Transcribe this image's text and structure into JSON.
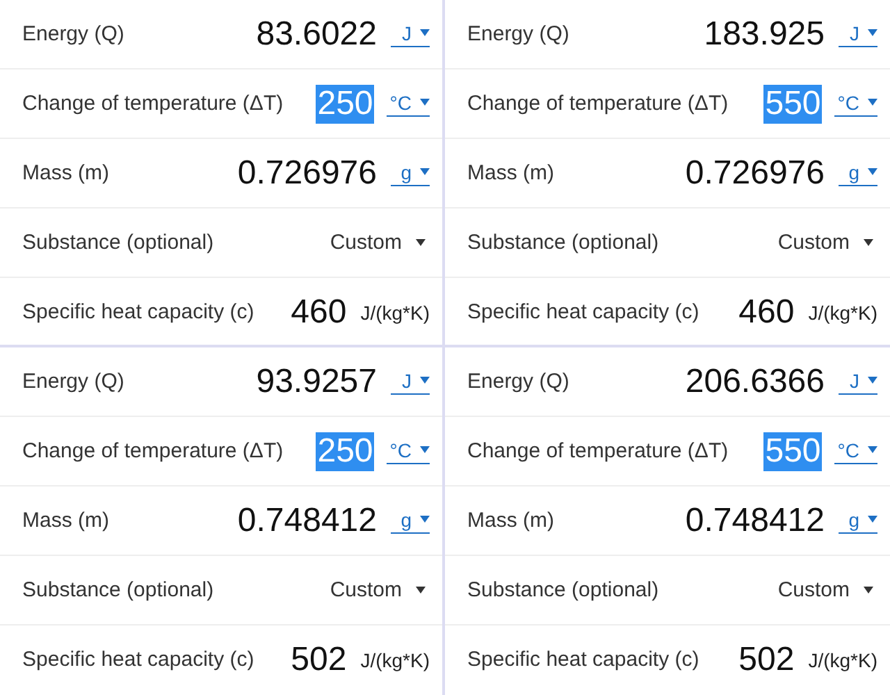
{
  "panels": [
    {
      "rows": [
        {
          "label": "Energy (Q)",
          "kind": "unit",
          "value": "83.6022",
          "selected": false,
          "unit": "J"
        },
        {
          "label": "Change of temperature (ΔT)",
          "kind": "unit",
          "value": "250",
          "selected": true,
          "unit": "°C"
        },
        {
          "label": "Mass (m)",
          "kind": "unit",
          "value": "0.726976",
          "selected": false,
          "unit": "g"
        },
        {
          "label": "Substance (optional)",
          "kind": "select",
          "value": "Custom"
        },
        {
          "label": "Specific heat capacity (c)",
          "kind": "fixed",
          "value": "460",
          "unit": "J/(kg*K)"
        }
      ]
    },
    {
      "rows": [
        {
          "label": "Energy (Q)",
          "kind": "unit",
          "value": "183.925",
          "selected": false,
          "unit": "J"
        },
        {
          "label": "Change of temperature (ΔT)",
          "kind": "unit",
          "value": "550",
          "selected": true,
          "unit": "°C"
        },
        {
          "label": "Mass (m)",
          "kind": "unit",
          "value": "0.726976",
          "selected": false,
          "unit": "g"
        },
        {
          "label": "Substance (optional)",
          "kind": "select",
          "value": "Custom"
        },
        {
          "label": "Specific heat capacity (c)",
          "kind": "fixed",
          "value": "460",
          "unit": "J/(kg*K)"
        }
      ]
    },
    {
      "rows": [
        {
          "label": "Energy (Q)",
          "kind": "unit",
          "value": "93.9257",
          "selected": false,
          "unit": "J"
        },
        {
          "label": "Change of temperature (ΔT)",
          "kind": "unit",
          "value": "250",
          "selected": true,
          "unit": "°C"
        },
        {
          "label": "Mass (m)",
          "kind": "unit",
          "value": "0.748412",
          "selected": false,
          "unit": "g"
        },
        {
          "label": "Substance (optional)",
          "kind": "select",
          "value": "Custom"
        },
        {
          "label": "Specific heat capacity (c)",
          "kind": "fixed",
          "value": "502",
          "unit": "J/(kg*K)"
        }
      ]
    },
    {
      "rows": [
        {
          "label": "Energy (Q)",
          "kind": "unit",
          "value": "206.6366",
          "selected": false,
          "unit": "J"
        },
        {
          "label": "Change of temperature (ΔT)",
          "kind": "unit",
          "value": "550",
          "selected": true,
          "unit": "°C"
        },
        {
          "label": "Mass (m)",
          "kind": "unit",
          "value": "0.748412",
          "selected": false,
          "unit": "g"
        },
        {
          "label": "Substance (optional)",
          "kind": "select",
          "value": "Custom"
        },
        {
          "label": "Specific heat capacity (c)",
          "kind": "fixed",
          "value": "502",
          "unit": "J/(kg*K)"
        }
      ]
    }
  ]
}
